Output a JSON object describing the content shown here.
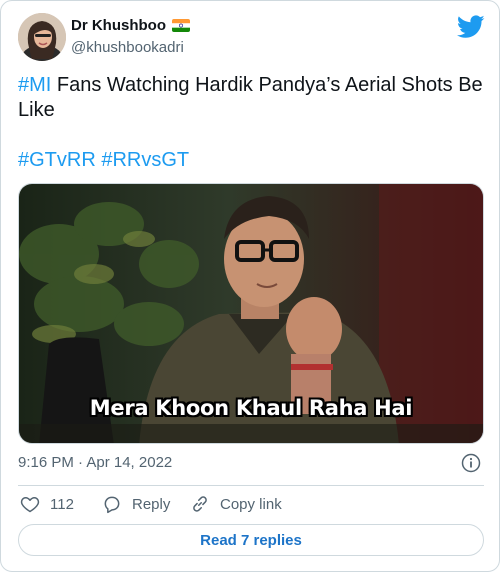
{
  "author": {
    "display_name": "Dr Khushboo",
    "handle": "@khushbookadri"
  },
  "tweet": {
    "hashtag_mi": "#MI",
    "text_rest": " Fans Watching Hardik Pandya’s Aerial Shots Be Like",
    "hashtags_line": "#GTvRR #RRvsGT"
  },
  "media": {
    "caption": "Mera Khoon Khaul Raha Hai"
  },
  "meta": {
    "timestamp": "9:16 PM · Apr 14, 2022"
  },
  "actions": {
    "like_count": "112",
    "reply_label": "Reply",
    "copy_label": "Copy link"
  },
  "read_replies": "Read 7 replies",
  "icons": {
    "brand": "twitter-bird-icon",
    "like": "heart-icon",
    "reply": "reply-bubble-icon",
    "copy": "link-icon",
    "info": "info-icon",
    "flag": "india-flag-icon"
  },
  "colors": {
    "accent": "#1d9bf0",
    "text": "#0f1419",
    "muted": "#536471",
    "border": "#cfd9de",
    "button_text": "#1d74c8"
  }
}
